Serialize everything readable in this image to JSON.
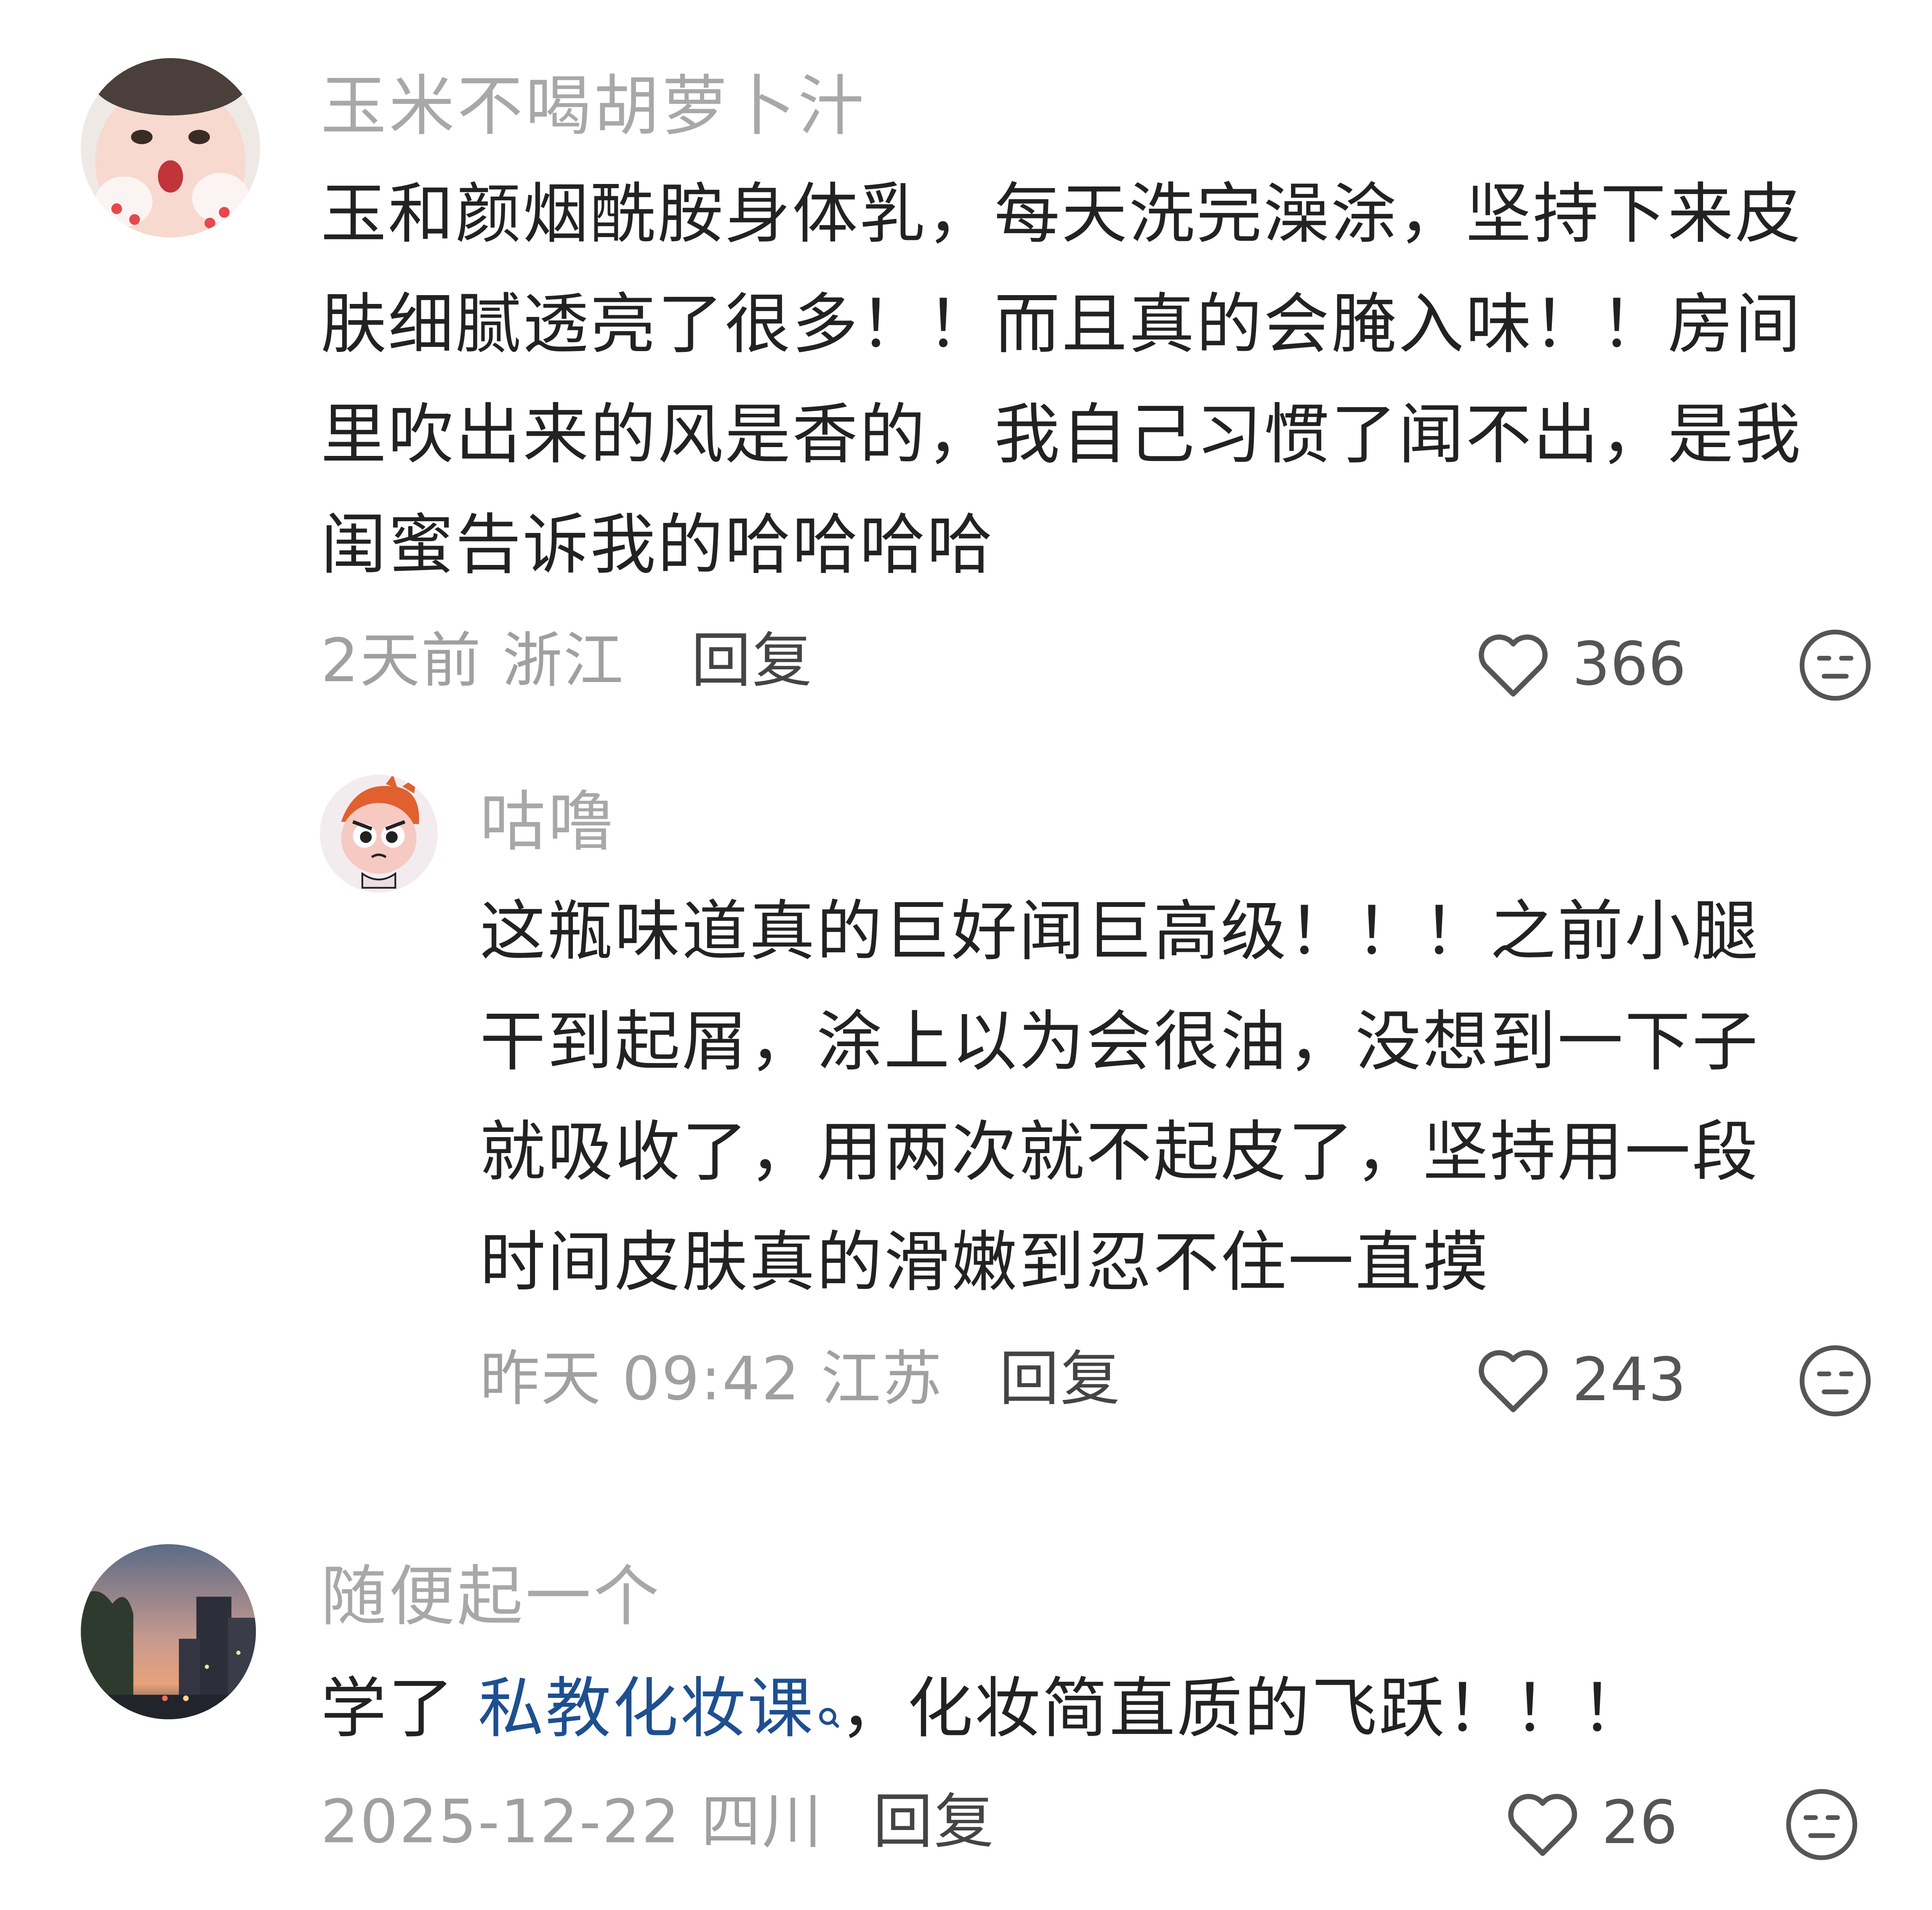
{
  "comments": [
    {
      "username": "玉米不喝胡萝卜汁",
      "body_lines": [
        "玉和颜烟酰胺身体乳，每天洗完澡涂，坚持下来皮",
        "肤细腻透亮了很多！！而且真的会腌入味！！房间",
        "里吹出来的风是香的，我自己习惯了闻不出，是我",
        "闺蜜告诉我的哈哈哈哈"
      ],
      "meta": "2天前 浙江",
      "reply_label": "回复",
      "likes": "366"
    },
    {
      "username": "咕噜",
      "body_lines": [
        "这瓶味道真的巨好闻巨高级！！！之前小腿",
        "干到起屑，涂上以为会很油，没想到一下子",
        "就吸收了，用两次就不起皮了，坚持用一段",
        "时间皮肤真的滑嫩到忍不住一直摸"
      ],
      "meta": "昨天 09:42 江苏",
      "reply_label": "回复",
      "likes": "243"
    },
    {
      "username": "随便起一个",
      "body_prefix": "学了 ",
      "body_link": "私教化妆课",
      "body_suffix": "，化妆简直质的飞跃！！！",
      "meta": "2025-12-22 四川",
      "reply_label": "回复",
      "likes": "26"
    }
  ],
  "icons": {
    "like": "heart-outline-icon",
    "dislike": "meh-face-icon",
    "link_search": "search-icon"
  },
  "colors": {
    "username": "#a8a8a8",
    "body": "#222222",
    "meta": "#a0a0a0",
    "link": "#1e4f8f"
  }
}
